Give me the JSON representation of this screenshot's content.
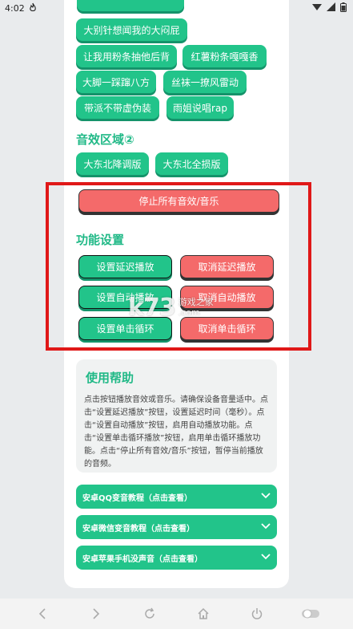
{
  "status_bar": {
    "time": "4:02",
    "notification_icon": "flame-icon"
  },
  "top_buttons": [
    {
      "label": "大别针想闻我的大闷屁"
    },
    {
      "label": "让我用粉条抽他后背"
    },
    {
      "label": "红薯粉条嘎嘎香"
    },
    {
      "label": "大脚一踩蹿八方"
    },
    {
      "label": "丝袜一撩风雷动"
    },
    {
      "label": "带派不带虚伪装"
    },
    {
      "label": "雨姐说唱rap"
    }
  ],
  "sound_zone2": {
    "title": "音效区域②",
    "buttons": [
      {
        "label": "大东北降调版"
      },
      {
        "label": "大东北全损版"
      }
    ]
  },
  "stop_all_label": "停止所有音效/音乐",
  "function_settings": {
    "title": "功能设置",
    "set_delay": "设置延迟播放",
    "cancel_delay": "取消延迟播放",
    "set_auto": "设置自动播放",
    "cancel_auto": "取消自动播放",
    "set_loop": "设置单击循环",
    "cancel_loop": "取消单击循环"
  },
  "watermark": {
    "logo": "k73",
    "text": "游戏之家",
    "domain": ".com"
  },
  "help": {
    "title": "使用帮助",
    "text": "点击按钮播放音效或音乐。请确保设备音量适中。点击“设置延迟播放”按钮，设置延迟时间（毫秒）。点击“设置自动播放”按钮，启用自动播放功能。点击“设置单击循环播放”按钮，启用单击循环播放功能。点击“停止所有音效/音乐”按钮，暂停当前播放的音频。"
  },
  "accordions": [
    {
      "label": "安卓QQ变音教程（点击查看）"
    },
    {
      "label": "安卓微信变音教程（点击查看）"
    },
    {
      "label": "安卓苹果手机没声音（点击查看）"
    }
  ],
  "colors": {
    "accent_green": "#22c48a",
    "stop_red": "#f46a6a",
    "frame_red": "#e01818"
  }
}
